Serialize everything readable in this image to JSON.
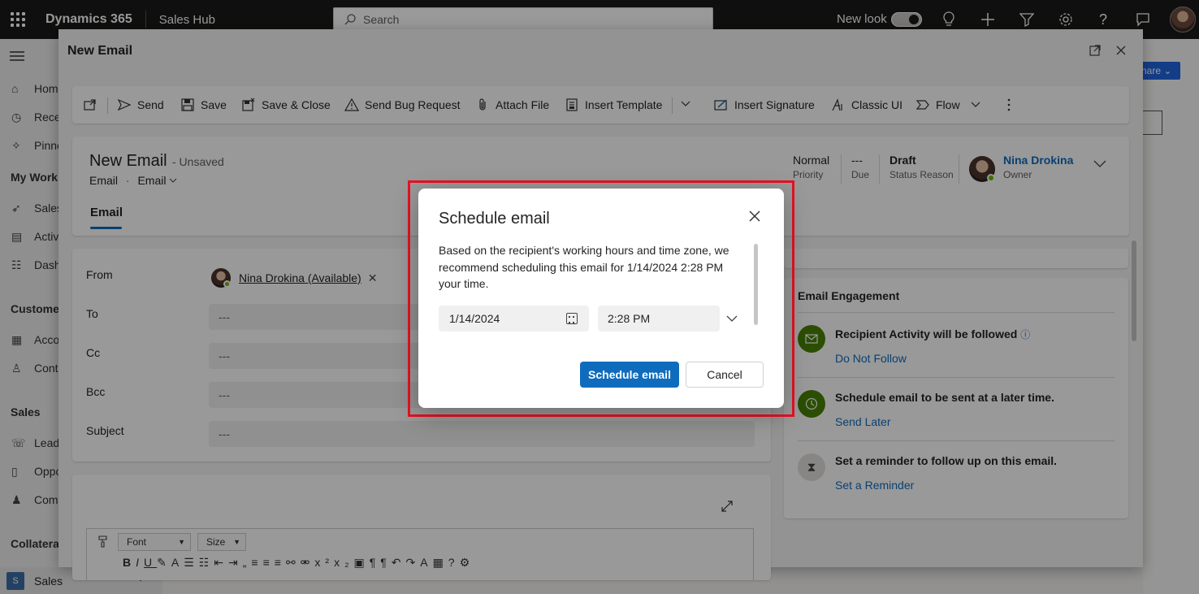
{
  "topbar": {
    "brand": "Dynamics 365",
    "app_name": "Sales Hub",
    "search_placeholder": "Search",
    "new_look_label": "New look"
  },
  "leftnav": {
    "items": [
      {
        "label": "Home",
        "icon": "home-icon"
      },
      {
        "label": "Recent",
        "icon": "clock-icon"
      },
      {
        "label": "Pinned",
        "icon": "pin-icon"
      }
    ],
    "section_my_work": "My Work",
    "my_work_items": [
      {
        "label": "Sales accelerator"
      },
      {
        "label": "Activities"
      },
      {
        "label": "Dashboards"
      }
    ],
    "section_customers": "Customers",
    "customer_items": [
      {
        "label": "Accounts"
      },
      {
        "label": "Contacts"
      }
    ],
    "section_sales": "Sales",
    "sales_items": [
      {
        "label": "Leads"
      },
      {
        "label": "Opportunities"
      },
      {
        "label": "Competitors"
      }
    ],
    "section_collateral": "Collateral",
    "area_badge": "S",
    "area_label": "Sales"
  },
  "background": {
    "share_label": "hare"
  },
  "panel": {
    "title": "New Email",
    "commands": {
      "send": "Send",
      "save": "Save",
      "save_close": "Save & Close",
      "send_bug": "Send Bug Request",
      "attach": "Attach File",
      "insert_template": "Insert Template",
      "insert_signature": "Insert Signature",
      "classic_ui": "Classic UI",
      "flow": "Flow"
    },
    "header": {
      "title": "New Email",
      "unsaved": "- Unsaved",
      "entity": "Email",
      "form_selector": "Email",
      "priority_value": "Normal",
      "priority_label": "Priority",
      "due_value": "---",
      "due_label": "Due",
      "status_value": "Draft",
      "status_label": "Status Reason",
      "owner_value": "Nina Drokina",
      "owner_label": "Owner",
      "tab": "Email"
    },
    "form": {
      "from_label": "From",
      "from_value": "Nina Drokina (Available)",
      "to_label": "To",
      "to_value": "---",
      "cc_label": "Cc",
      "cc_value": "---",
      "bcc_label": "Bcc",
      "bcc_value": "---",
      "subject_label": "Subject",
      "subject_value": "---"
    },
    "editor": {
      "font_label": "Font",
      "size_label": "Size"
    },
    "engagement": {
      "title": "Email Engagement",
      "items": [
        {
          "text": "Recipient Activity will be followed",
          "link": "Do Not Follow"
        },
        {
          "text": "Schedule email to be sent at a later time.",
          "link": "Send Later"
        },
        {
          "text": "Set a reminder to follow up on this email.",
          "link": "Set a Reminder"
        }
      ]
    }
  },
  "dialog": {
    "title": "Schedule email",
    "body": "Based on the recipient's working hours and time zone, we recommend scheduling this email for 1/14/2024 2:28 PM your time.",
    "date_value": "1/14/2024",
    "time_value": "2:28 PM",
    "primary_label": "Schedule email",
    "secondary_label": "Cancel"
  },
  "colors": {
    "primary": "#0f6cbd",
    "topbar": "#1b1a19",
    "highlight": "#e81123",
    "engagement_green": "#498205"
  }
}
